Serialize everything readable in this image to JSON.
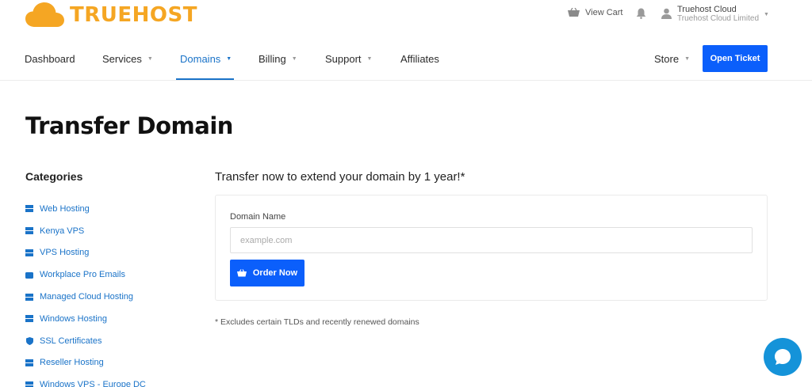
{
  "brand": {
    "name": "TRUEHOST",
    "color": "#f5a623",
    "logo_icon": "cloud-icon"
  },
  "topbar": {
    "cart_label": "View Cart",
    "cart_icon": "basket-icon",
    "bell_icon": "bell-icon",
    "account_name": "Truehost Cloud",
    "account_company": "Truehost Cloud Limited",
    "account_icon": "user-icon"
  },
  "nav": {
    "items": [
      {
        "label": "Dashboard"
      },
      {
        "label": "Services"
      },
      {
        "label": "Domains",
        "active": true
      },
      {
        "label": "Billing"
      },
      {
        "label": "Support"
      },
      {
        "label": "Affiliates"
      }
    ],
    "store_label": "Store",
    "open_ticket_label": "Open Ticket",
    "accent": "#1a73c8",
    "button_color": "#0b5ffb"
  },
  "page": {
    "title": "Transfer Domain"
  },
  "sidebar": {
    "title": "Categories",
    "items": [
      {
        "label": "Web Hosting",
        "icon": "server-icon"
      },
      {
        "label": "Kenya VPS",
        "icon": "server-icon"
      },
      {
        "label": "VPS Hosting",
        "icon": "server-icon"
      },
      {
        "label": "Workplace Pro Emails",
        "icon": "box-icon"
      },
      {
        "label": "Managed Cloud Hosting",
        "icon": "server-icon"
      },
      {
        "label": "Windows Hosting",
        "icon": "server-icon"
      },
      {
        "label": "SSL Certificates",
        "icon": "shield-icon"
      },
      {
        "label": "Reseller Hosting",
        "icon": "server-icon"
      },
      {
        "label": "Windows VPS - Europe DC",
        "icon": "server-icon"
      }
    ]
  },
  "transfer": {
    "headline": "Transfer now to extend your domain by 1 year!*",
    "field_label": "Domain Name",
    "input_placeholder": "example.com",
    "input_value": "",
    "order_label": "Order Now",
    "order_icon": "basket-icon",
    "footnote": "* Excludes certain TLDs and recently renewed domains"
  },
  "chat": {
    "icon": "chat-bubble-icon",
    "color": "#1593d9"
  }
}
